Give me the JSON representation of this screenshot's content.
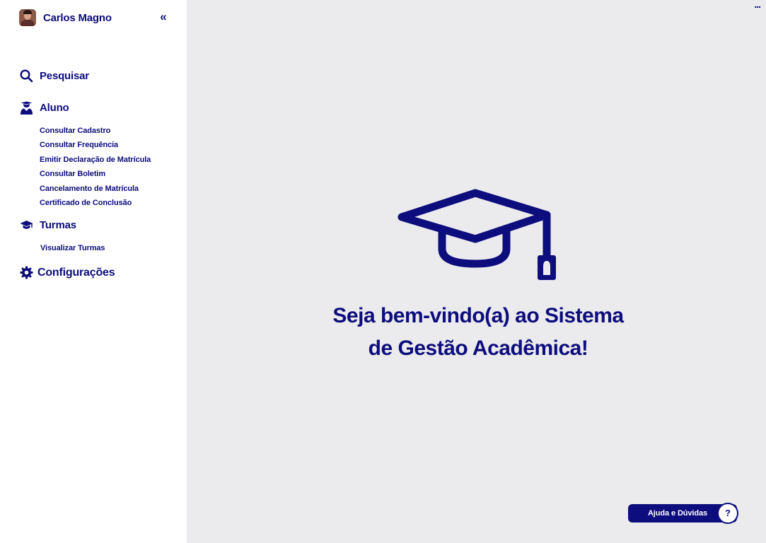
{
  "user": {
    "name": "Carlos Magno"
  },
  "sidebar": {
    "collapse_label": "«",
    "search": {
      "label": "Pesquisar",
      "icon": "search-icon"
    },
    "aluno": {
      "label": "Aluno",
      "icon": "student-icon",
      "items": [
        "Consultar Cadastro",
        "Consultar Frequência",
        "Emitir Declaração de Matrícula",
        "Consultar Boletim",
        "Cancelamento de Matrícula",
        "Certificado de Conclusão"
      ]
    },
    "turmas": {
      "label": "Turmas",
      "icon": "graduation-cap-icon",
      "items": [
        "Visualizar Turmas"
      ]
    },
    "config": {
      "label": "Configurações",
      "icon": "gear-icon"
    }
  },
  "main": {
    "more_label": "...",
    "welcome_line1": "Seja bem-vindo(a) ao Sistema",
    "welcome_line2": "de Gestão Acadêmica!",
    "help_label": "Ajuda e Dúvidas",
    "help_icon_label": "?"
  },
  "colors": {
    "primary": "#0D0D7D",
    "sidebar_bg": "#FFFFFF",
    "main_bg": "#EBEBED"
  }
}
